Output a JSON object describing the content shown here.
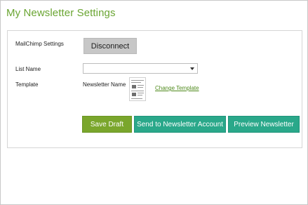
{
  "page": {
    "title": "My Newsletter Settings"
  },
  "form": {
    "mailchimp_label": "MailChimp Settings",
    "disconnect_label": "Disconnect",
    "list_name_label": "List Name",
    "list_name_value": "",
    "template_label": "Template",
    "newsletter_name_label": "Newsletter Name",
    "change_template_label": "Change Template"
  },
  "actions": {
    "save_draft_label": "Save Draft",
    "send_label": "Send to Newsletter Account",
    "preview_label": "Preview Newsletter"
  },
  "colors": {
    "title_green": "#6aa532",
    "save_green": "#7aa62c",
    "action_teal": "#2aa88a",
    "link_green": "#4f8a1c",
    "disconnect_gray": "#c7c7c7"
  },
  "icons": {
    "dropdown": "chevron-down-icon",
    "template_preview": "template-thumbnail"
  }
}
